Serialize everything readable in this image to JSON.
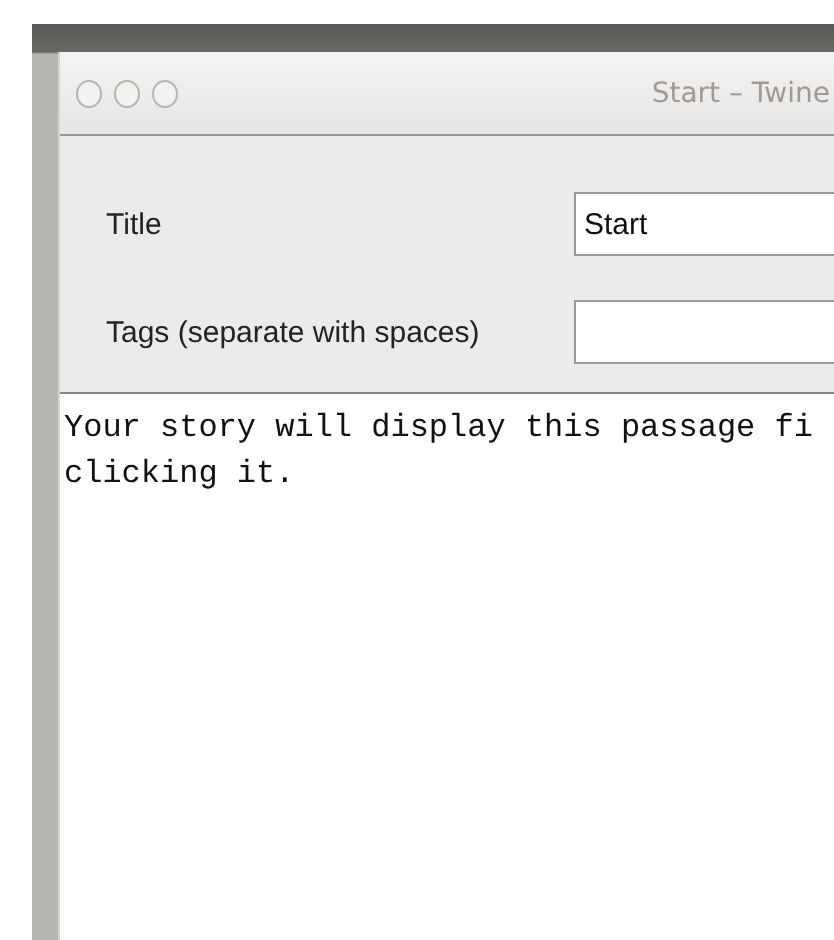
{
  "window": {
    "title": "Start – Twine"
  },
  "fields": [
    {
      "label": "Title",
      "value": "Start"
    },
    {
      "label": "Tags (separate with spaces)"
    }
  ],
  "passage": {
    "lines": [
      "Your story will display this passage fi",
      "clicking it."
    ]
  }
}
